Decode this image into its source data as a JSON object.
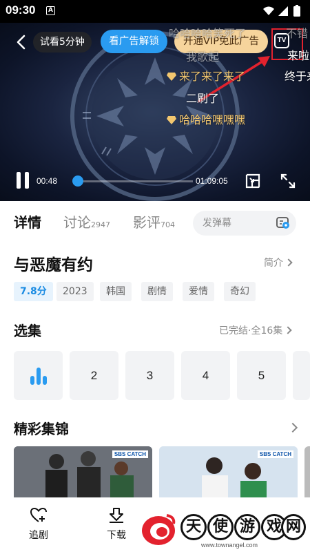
{
  "status_bar": {
    "time": "09:30",
    "notification_letter": "A"
  },
  "player": {
    "trial_label": "试看5分钟",
    "ad_unlock_label": "看广告解锁",
    "vip_label": "开通VIP免此广告",
    "tv_label": "TV",
    "current_time": "00:48",
    "total_time": "01:09:05",
    "progress_percent": 1.2,
    "danmu": [
      "哈哈哈哈笑死了",
      "不错",
      "我歌起",
      "来啦",
      "来了来了来了",
      "终于来",
      "二刷了",
      "哈哈哈嘿嘿嘿"
    ]
  },
  "tabs": [
    {
      "label": "详情",
      "count": ""
    },
    {
      "label": "讨论",
      "count": "2947"
    },
    {
      "label": "影评",
      "count": "704"
    }
  ],
  "danmu_input": {
    "placeholder": "发弹幕"
  },
  "show": {
    "title": "与恶魔有约",
    "intro_link": "简介",
    "tags": [
      "7.8分",
      "2023",
      "韩国",
      "剧情",
      "爱情",
      "奇幻"
    ]
  },
  "episodes": {
    "heading": "选集",
    "status": "已完结·全16集",
    "items": [
      "",
      "2",
      "3",
      "4",
      "5"
    ]
  },
  "highlights": {
    "heading": "精彩集锦",
    "clips": [
      {
        "badge": "SBS CATCH"
      },
      {
        "badge": "SBS CATCH"
      }
    ]
  },
  "bottom_bar": {
    "follow_label": "追剧",
    "download_label": "下载"
  },
  "watermark": {
    "chars": [
      "天",
      "使",
      "游",
      "戏",
      "网"
    ],
    "url": "www.townangel.com"
  },
  "colors": {
    "accent_blue": "#2a9bf0",
    "vip_gold": "#f6d49c",
    "highlight_red": "#e3222e",
    "danmu_gold": "#f3c76f"
  }
}
